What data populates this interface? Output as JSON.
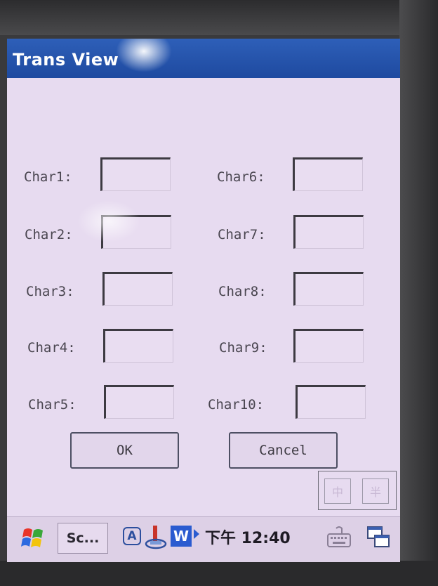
{
  "window": {
    "title": "Trans View"
  },
  "fields": [
    {
      "label": "Char1:",
      "value": ""
    },
    {
      "label": "Char2:",
      "value": ""
    },
    {
      "label": "Char3:",
      "value": ""
    },
    {
      "label": "Char4:",
      "value": ""
    },
    {
      "label": "Char5:",
      "value": ""
    },
    {
      "label": "Char6:",
      "value": ""
    },
    {
      "label": "Char7:",
      "value": ""
    },
    {
      "label": "Char8:",
      "value": ""
    },
    {
      "label": "Char9:",
      "value": ""
    },
    {
      "label": "Char10:",
      "value": ""
    }
  ],
  "buttons": {
    "ok": "OK",
    "cancel": "Cancel"
  },
  "ime": {
    "chinese": "中",
    "half_width": "半"
  },
  "taskbar": {
    "start_icon": "windows-flag-icon",
    "app_button": "Sc...",
    "tray_input_indicator": "A",
    "tray_word_icon": "W",
    "clock": "下午 12:40",
    "keyboard_icon": "keyboard-icon",
    "windows_icon": "task-switch-icon"
  },
  "colors": {
    "title_bar": "#1e4aa0",
    "screen_background": "#e7dbf0",
    "text": "#4a4650"
  }
}
